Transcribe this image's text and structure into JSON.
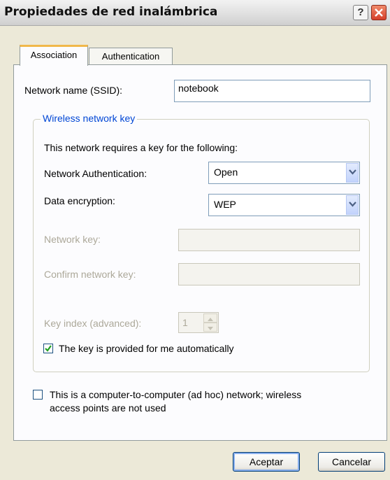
{
  "window": {
    "title": "Propiedades de red inalámbrica"
  },
  "tabs": [
    {
      "label": "Association"
    },
    {
      "label": "Authentication"
    }
  ],
  "ssid": {
    "label": "Network name (SSID):",
    "value": "notebook"
  },
  "key_group": {
    "title": "Wireless network key",
    "intro": "This network requires a key for the following:",
    "auth_label": "Network Authentication:",
    "auth_value": "Open",
    "enc_label": "Data encryption:",
    "enc_value": "WEP",
    "netkey_label": "Network key:",
    "confirm_label": "Confirm network key:",
    "index_label": "Key index (advanced):",
    "index_value": "1",
    "auto_label": "The key is provided for me automatically",
    "auto_checked": true
  },
  "adhoc": {
    "label_line1": "This is a computer-to-computer (ad hoc) network; wireless",
    "label_line2": "access points are not used",
    "checked": false
  },
  "buttons": {
    "ok": "Aceptar",
    "cancel": "Cancelar"
  },
  "colors": {
    "group_title": "#0046d5",
    "tab_highlight": "#f1b84a",
    "close_button": "#d5402a"
  }
}
